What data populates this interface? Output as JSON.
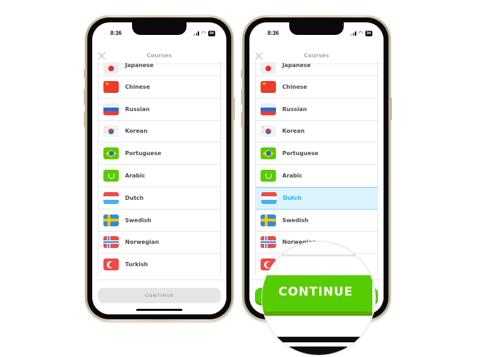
{
  "status_bar": {
    "time": "8:36",
    "battery": "94"
  },
  "header": {
    "title": "Courses"
  },
  "courses": [
    {
      "label": "Japanese",
      "flag": "japanese-flag-icon"
    },
    {
      "label": "Chinese",
      "flag": "chinese-flag-icon"
    },
    {
      "label": "Russian",
      "flag": "russian-flag-icon"
    },
    {
      "label": "Korean",
      "flag": "korean-flag-icon"
    },
    {
      "label": "Portuguese",
      "flag": "portuguese-flag-icon"
    },
    {
      "label": "Arabic",
      "flag": "arabic-flag-icon"
    },
    {
      "label": "Dutch",
      "flag": "dutch-flag-icon"
    },
    {
      "label": "Swedish",
      "flag": "swedish-flag-icon"
    },
    {
      "label": "Norwegian",
      "flag": "norwegian-flag-icon"
    },
    {
      "label": "Turkish",
      "flag": "turkish-flag-icon"
    }
  ],
  "left_phone": {
    "selected": null,
    "continue_label": "CONTINUE",
    "continue_enabled": false
  },
  "right_phone": {
    "selected": "Dutch",
    "continue_label": "CONTINUE",
    "continue_enabled": true
  },
  "magnifier": {
    "label": "CONTINUE"
  },
  "colors": {
    "accent_green": "#58cc02",
    "selected_blue": "#1cb0f6",
    "selected_bg": "#ddf4ff",
    "disabled_gray": "#e5e5e5"
  }
}
